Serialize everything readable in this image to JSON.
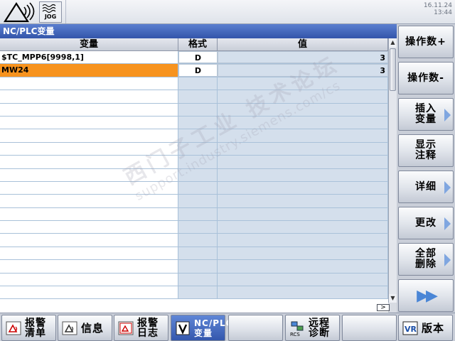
{
  "topbar": {
    "jog_label": "JOG",
    "date": "16.11.24",
    "time": "13:44"
  },
  "panel": {
    "title": "NC/PLC变量",
    "columns": [
      "变量",
      "格式",
      "值"
    ],
    "rows": [
      {
        "variable": "$TC_MPP6[9998,1]",
        "format": "D",
        "value": "3"
      },
      {
        "variable": "MW24",
        "format": "D",
        "value": "3"
      }
    ],
    "empty_row_count": 17,
    "scroll_right": ">"
  },
  "softkeys_right": [
    {
      "label": "操作数+",
      "arrow": false
    },
    {
      "label": "操作数-",
      "arrow": false
    },
    {
      "label": "插入\n变量",
      "arrow": true
    },
    {
      "label": "显示\n注释",
      "arrow": false
    },
    {
      "label": "详细",
      "arrow": true
    },
    {
      "label": "更改",
      "arrow": true
    },
    {
      "label": "全部\n删除",
      "arrow": true
    },
    {
      "label": "▶▶",
      "arrow": false
    }
  ],
  "softkeys_bottom": [
    {
      "label": "报警\n清单",
      "icon": "alarm-list-icon",
      "active": false
    },
    {
      "label": "信息",
      "icon": "message-icon",
      "active": false
    },
    {
      "label": "报警\n日志",
      "icon": "alarm-log-icon",
      "active": false
    },
    {
      "label": "NC/PLC\n变量",
      "icon": "variable-icon",
      "active": true
    },
    {
      "label": "",
      "icon": "",
      "active": false
    },
    {
      "label": "远程\n诊断",
      "icon": "remote-diagnosis-icon",
      "active": false
    },
    {
      "label": "",
      "icon": "",
      "active": false
    },
    {
      "label": "版本",
      "icon": "version-icon",
      "active": false
    }
  ],
  "watermark": {
    "line1": "西门子工业 技术论坛",
    "line2": "support.industry.siemens.com/cs"
  },
  "colors": {
    "title_bar": "#3355aa",
    "selected_row": "#f7931e",
    "cell_blue": "#d4dfec"
  }
}
